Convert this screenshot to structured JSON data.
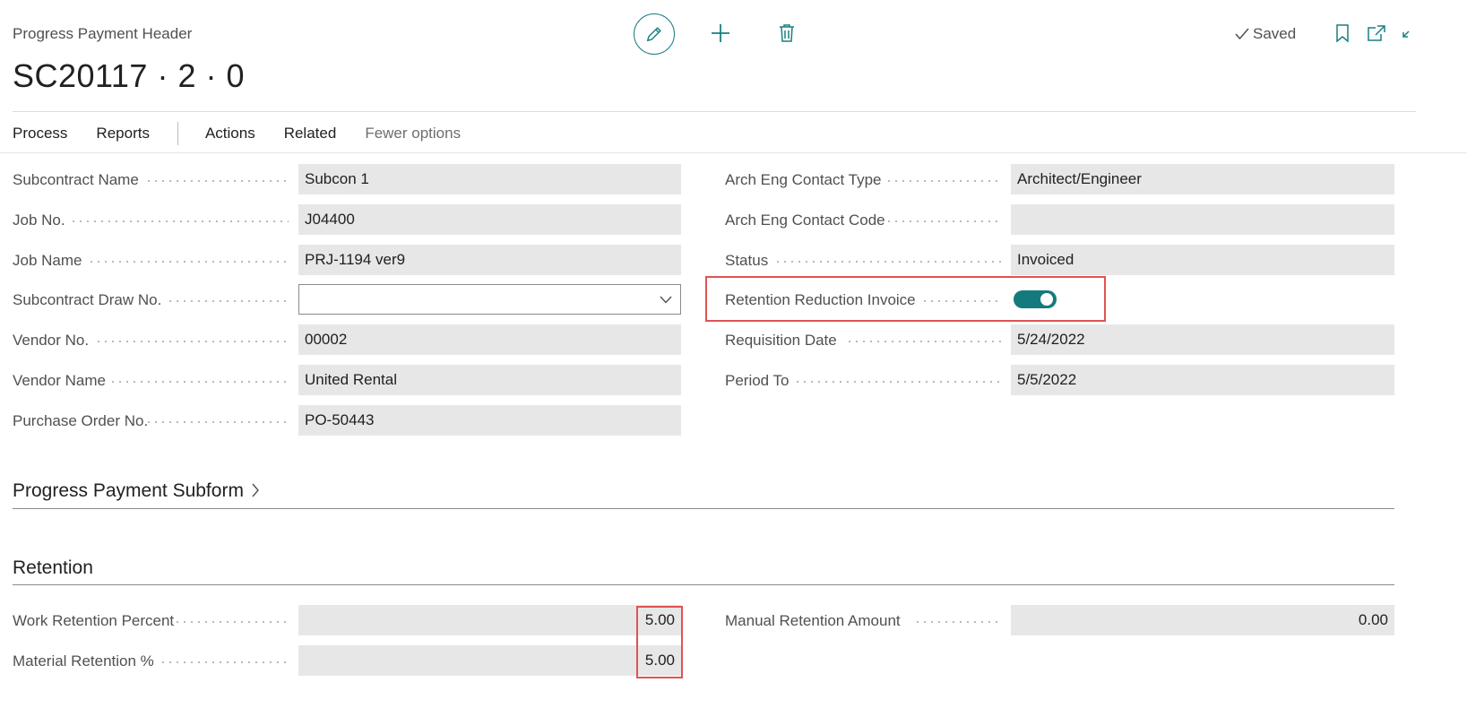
{
  "header": {
    "caption": "Progress Payment Header",
    "title": "SC20117 · 2 · 0",
    "saved_label": "Saved"
  },
  "actions": {
    "process": "Process",
    "reports": "Reports",
    "actions": "Actions",
    "related": "Related",
    "fewer_options": "Fewer options"
  },
  "general": {
    "left": [
      {
        "label": "Subcontract Name",
        "value": "Subcon 1"
      },
      {
        "label": "Job No.",
        "value": "J04400"
      },
      {
        "label": "Job Name",
        "value": "PRJ-1194 ver9"
      },
      {
        "label": "Subcontract Draw No.",
        "value": ""
      },
      {
        "label": "Vendor No.",
        "value": "00002"
      },
      {
        "label": "Vendor Name",
        "value": "United Rental"
      },
      {
        "label": "Purchase Order No.",
        "value": "PO-50443"
      }
    ],
    "right": [
      {
        "label": "Arch Eng Contact Type",
        "value": "Architect/Engineer"
      },
      {
        "label": "Arch Eng Contact Code",
        "value": ""
      },
      {
        "label": "Status",
        "value": "Invoiced"
      },
      {
        "label": "Retention Reduction Invoice",
        "value": true
      },
      {
        "label": "Requisition Date",
        "value": "5/24/2022"
      },
      {
        "label": "Period To",
        "value": "5/5/2022"
      }
    ]
  },
  "subform": {
    "title": "Progress Payment Subform"
  },
  "retention": {
    "title": "Retention",
    "work_retention_percent": {
      "label": "Work Retention Percent",
      "value": "5.00"
    },
    "material_retention": {
      "label": "Material Retention %",
      "value": "5.00"
    },
    "manual_retention_amount": {
      "label": "Manual Retention Amount",
      "value": "0.00"
    }
  },
  "colors": {
    "accent": "#1a7f7f",
    "highlight": "#e05353",
    "field_bg": "#e7e7e8"
  }
}
